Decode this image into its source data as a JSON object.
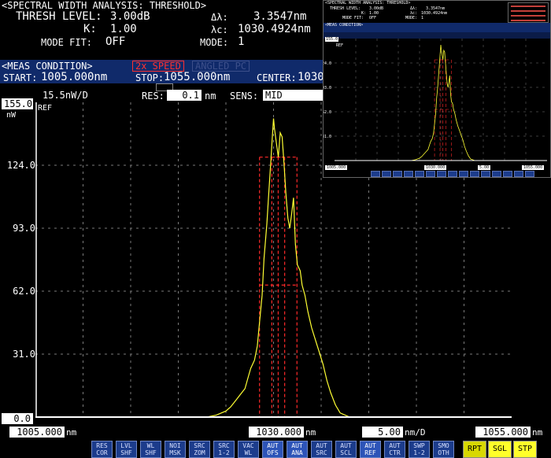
{
  "analysis": {
    "title": "<SPECTRAL WIDTH ANALYSIS: THRESHOLD>",
    "thresh_label": "THRESH LEVEL:",
    "thresh_value": "3.00dB",
    "k_label": "K:",
    "k_value": "1.00",
    "modefit_label": "MODE FIT:",
    "modefit_value": "OFF",
    "dl_label": "Δλ:",
    "dl_value": "3.3547nm",
    "lc_label": "λc:",
    "lc_value": "1030.4924nm",
    "mode_label": "MODE:",
    "mode_value": "1"
  },
  "meas": {
    "title": "<MEAS CONDITION>",
    "speed_label": "2x SPEED",
    "angled_label": "ANGLED PC",
    "start_label": "START:",
    "start_value": "1005.000nm",
    "stop_label": "STOP:",
    "stop_value": "1055.000nm",
    "center_label": "CENTER:",
    "center_value": "1030"
  },
  "status": {
    "scale_value": "15.5nW/D",
    "res_label": "RES:",
    "res_value": "0.1",
    "res_unit": "nm",
    "sens_label": "SENS:",
    "sens_value": "MID"
  },
  "plot": {
    "top_value": "155.0",
    "top_unit": "nW",
    "ref_label": "REF",
    "bottom_value": "0.0",
    "start_value": "1005.000",
    "start_unit": "nm",
    "center_value": "1030.000",
    "center_unit": "nm",
    "span_value": "5.00",
    "span_unit": "nm/D",
    "stop_value": "1055.000",
    "stop_unit": "nm",
    "trace_color": "#ffff33",
    "marker_color": "#ff2a2a"
  },
  "chart_data": {
    "type": "line",
    "xlim": [
      1005.0,
      1055.0
    ],
    "ylim": [
      0.0,
      155.0
    ],
    "y_tick_labels": [
      "124.0",
      "93.0",
      "62.0",
      "31.0"
    ],
    "y_ticks": [
      124.0,
      93.0,
      62.0,
      31.0
    ],
    "grid": true,
    "markers_x": [
      1028.53,
      1029.82,
      1030.49,
      1031.17,
      1032.46
    ],
    "series": [
      {
        "x": [
          1005.0,
          1023.0,
          1024.0,
          1025.0,
          1025.5,
          1026.0,
          1026.5,
          1027.0,
          1027.3,
          1027.6,
          1028.0,
          1028.3,
          1028.5,
          1028.8,
          1029.0,
          1029.3,
          1029.5,
          1029.7,
          1029.9,
          1030.0,
          1030.1,
          1030.3,
          1030.5,
          1030.7,
          1030.9,
          1031.1,
          1031.3,
          1031.5,
          1031.7,
          1031.9,
          1032.1,
          1032.3,
          1032.5,
          1032.8,
          1033.0,
          1033.3,
          1033.6,
          1034.0,
          1034.4,
          1034.8,
          1035.2,
          1035.6,
          1036.0,
          1036.5,
          1037.0,
          1038.0,
          1055.0
        ],
        "y": [
          0,
          0,
          1,
          3,
          5,
          8,
          11,
          14,
          19,
          24,
          28,
          35,
          45,
          60,
          78,
          95,
          110,
          125,
          140,
          147,
          142,
          135,
          128,
          140,
          138,
          125,
          110,
          98,
          93,
          100,
          108,
          85,
          75,
          72,
          65,
          60,
          52,
          44,
          38,
          32,
          26,
          18,
          12,
          6,
          2,
          0,
          0
        ]
      }
    ]
  },
  "inset": {
    "title": "<SPECTRAL WIDTH ANALYSIS: THRESHOLD>",
    "thresh_label": "THRESH LEVEL:",
    "thresh_value": "3.00dB",
    "k_label": "K:",
    "k_value": "1.00",
    "modefit_label": "MODE FIT:",
    "modefit_value": "OFF",
    "dl_label": "Δλ:",
    "dl_value": "3.3547nm",
    "lc_label": "λc:",
    "lc_value": "1030.4924nm",
    "mode_label": "MODE:",
    "mode_value": "1",
    "meas_title": "<MEAS CONDITION>",
    "top_value": "155.0",
    "ref_label": "REF",
    "start_value": "1005.000",
    "center_value": "1030.000",
    "span_value": "5.00",
    "stop_value": "1055.000",
    "res_value": "0.1",
    "sens_value": "MID",
    "ticks": [
      "124.0",
      "93.0",
      "62.0",
      "31.0"
    ]
  },
  "softkeys": [
    {
      "l1": "RES",
      "l2": "COR"
    },
    {
      "l1": "LVL",
      "l2": "SHF"
    },
    {
      "l1": "WL",
      "l2": "SHF"
    },
    {
      "l1": "NOI",
      "l2": "MSK"
    },
    {
      "l1": "SRC",
      "l2": "ZOM"
    },
    {
      "l1": "SRC",
      "l2": "1-2"
    },
    {
      "l1": "VAC",
      "l2": "WL"
    },
    {
      "l1": "AUT",
      "l2": "OFS"
    },
    {
      "l1": "AUT",
      "l2": "ANA"
    },
    {
      "l1": "AUT",
      "l2": "SRC"
    },
    {
      "l1": "AUT",
      "l2": "SCL"
    },
    {
      "l1": "AUT",
      "l2": "REF"
    },
    {
      "l1": "AUT",
      "l2": "CTR"
    },
    {
      "l1": "SWP",
      "l2": "1-2"
    },
    {
      "l1": "SMO",
      "l2": "OTH"
    }
  ],
  "sweep_buttons": {
    "rpt": "RPT",
    "sgl": "SGL",
    "stp": "STP"
  }
}
